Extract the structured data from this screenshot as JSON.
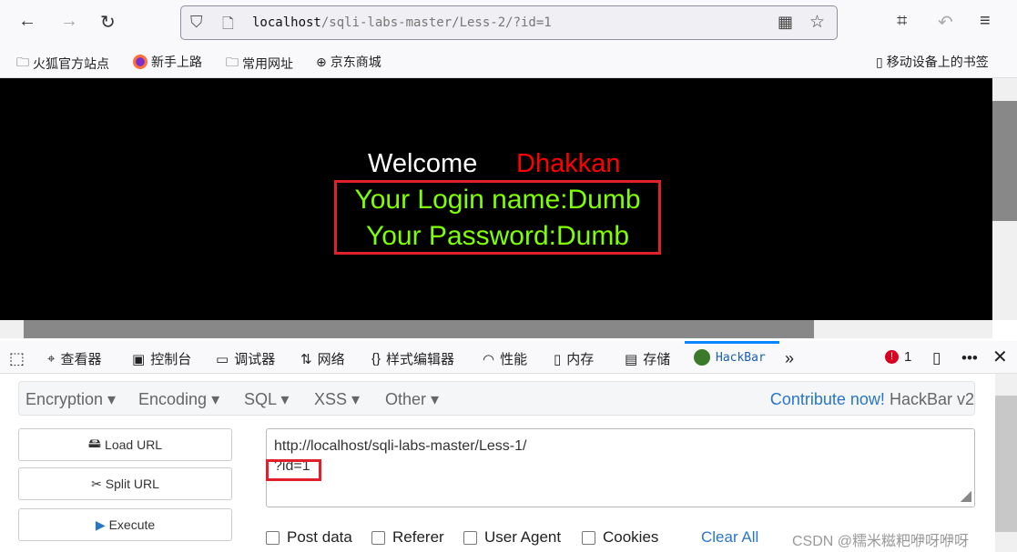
{
  "browser": {
    "url_host": "localhost",
    "url_path": "/sqli-labs-master/Less-2/?id=1"
  },
  "bookmarks": [
    "火狐官方站点",
    "新手上路",
    "常用网址",
    "京东商城"
  ],
  "mobile_bookmarks": "移动设备上的书签",
  "page": {
    "welcome": "Welcome",
    "name": "Dhakkan",
    "login": "Your Login name:Dumb",
    "password": "Your Password:Dumb"
  },
  "devtools": {
    "tabs": [
      "查看器",
      "控制台",
      "调试器",
      "网络",
      "样式编辑器",
      "性能",
      "内存",
      "存储",
      "HackBar"
    ],
    "error_count": "1"
  },
  "hackbar": {
    "menus": [
      "Encryption",
      "Encoding",
      "SQL",
      "XSS",
      "Other"
    ],
    "contribute": "Contribute now!",
    "version": "HackBar v2",
    "buttons": [
      "Load URL",
      "Split URL",
      "Execute"
    ],
    "url_line1": "http://localhost/sqli-labs-master/Less-1/",
    "url_line2": "?id=1",
    "checkboxes": [
      "Post data",
      "Referer",
      "User Agent",
      "Cookies"
    ],
    "clear_all": "Clear All"
  },
  "watermark": "CSDN @糯米糍粑咿呀咿呀",
  "colors": {
    "highlight": "#e0202a",
    "green_text": "#7fff00",
    "link": "#2a76c6"
  }
}
